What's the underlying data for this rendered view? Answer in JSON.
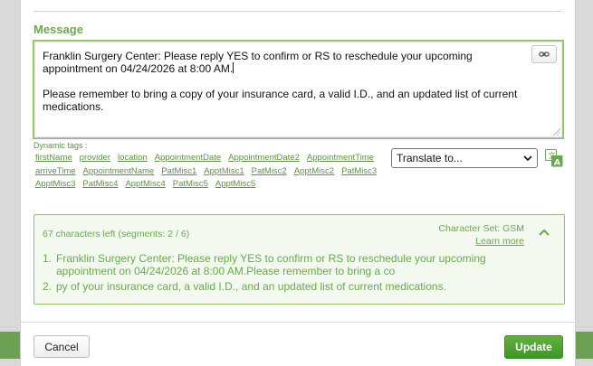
{
  "message": {
    "label": "Message",
    "line1": "Franklin Surgery Center: Please reply YES to confirm or RS to reschedule your upcoming appointment on 04/24/2026 at 8:00 AM.",
    "line2": "Please remember to bring a copy of your insurance card, a valid I.D., and an updated list of current medications."
  },
  "dynamic_tags": {
    "title": "Dynamic tags :",
    "items": [
      "firstName",
      "provider",
      "location",
      "AppointmentDate",
      "AppointmentDate2",
      "AppointmentTime",
      "arriveTime",
      "AppointmentName",
      "PatMisc1",
      "ApptMisc1",
      "PatMisc2",
      "ApptMisc2",
      "PatMisc3",
      "ApptMisc3",
      "PatMisc4",
      "ApptMisc4",
      "PatMisc5",
      "ApptMisc5"
    ]
  },
  "translate": {
    "selected": "Translate to..."
  },
  "preview": {
    "chars_left": "67 characters left (segments: 2 / 6)",
    "charset": "Character Set: GSM",
    "learn_more": "Learn more",
    "segments": [
      {
        "num": "1.",
        "text": "Franklin Surgery Center: Please reply YES to confirm or RS to reschedule your upcoming appointment on 04/24/2026 at 8:00 AM.Please remember to bring a co"
      },
      {
        "num": "2.",
        "text": "py of your insurance card, a valid I.D., and an updated list of current medications."
      }
    ]
  },
  "footer": {
    "cancel": "Cancel",
    "update": "Update"
  },
  "colors": {
    "accent": "#6aa84f",
    "primary_button": "#4a9c30"
  },
  "icons": {
    "link": "link-icon",
    "translate": "translate-icon",
    "collapse": "chevron-up-icon"
  }
}
